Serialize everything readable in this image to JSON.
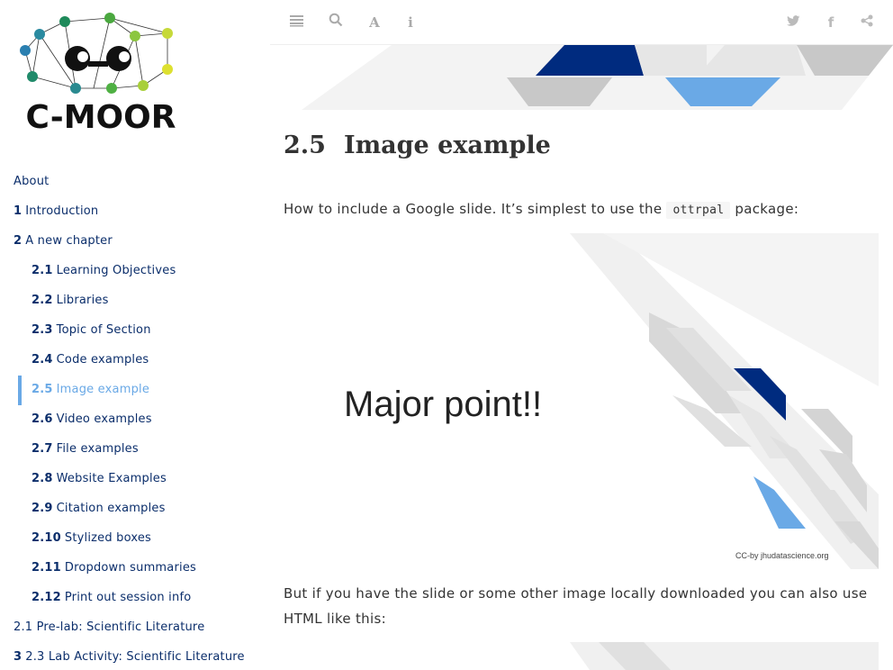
{
  "logo": {
    "text": "C-MOOR"
  },
  "toc": [
    {
      "num": "",
      "label": "About",
      "active": false
    },
    {
      "num": "1",
      "label": "Introduction",
      "active": false
    },
    {
      "num": "2",
      "label": "A new chapter",
      "active": false
    },
    {
      "num": "2.1",
      "label": "Learning Objectives",
      "active": false
    },
    {
      "num": "2.2",
      "label": "Libraries",
      "active": false
    },
    {
      "num": "2.3",
      "label": "Topic of Section",
      "active": false
    },
    {
      "num": "2.4",
      "label": "Code examples",
      "active": false
    },
    {
      "num": "2.5",
      "label": "Image example",
      "active": true
    },
    {
      "num": "2.6",
      "label": "Video examples",
      "active": false
    },
    {
      "num": "2.7",
      "label": "File examples",
      "active": false
    },
    {
      "num": "2.8",
      "label": "Website Examples",
      "active": false
    },
    {
      "num": "2.9",
      "label": "Citation examples",
      "active": false
    },
    {
      "num": "2.10",
      "label": "Stylized boxes",
      "active": false
    },
    {
      "num": "2.11",
      "label": "Dropdown summaries",
      "active": false
    },
    {
      "num": "2.12",
      "label": "Print out session info",
      "active": false
    },
    {
      "num": "",
      "label": "2.1 Pre-lab: Scientific Literature",
      "active": false
    },
    {
      "num": "3",
      "label": "2.3 Lab Activity: Scientific Literature",
      "active": false
    }
  ],
  "toolbar": {
    "left": [
      {
        "name": "toc-toggle-icon",
        "glyph": "≣"
      },
      {
        "name": "search-icon",
        "glyph": "⚲"
      },
      {
        "name": "font-settings-icon",
        "glyph": "A"
      },
      {
        "name": "info-icon",
        "glyph": "i"
      }
    ],
    "right": [
      {
        "name": "twitter-icon",
        "glyph": "🐦"
      },
      {
        "name": "facebook-icon",
        "glyph": "f"
      },
      {
        "name": "share-icon",
        "glyph": "⋖"
      }
    ]
  },
  "section": {
    "number": "2.5",
    "title": "Image example",
    "intro_before": "How to include a Google slide. It’s simplest to use the ",
    "intro_code": "ottrpal",
    "intro_after": " package:",
    "slide_text": "Major point!!",
    "slide_credit": "CC-by jhudatascience.org",
    "outro": "But if you have the slide or some other image locally downloaded you can also use HTML like this:"
  },
  "colors": {
    "accent": "#6aa9e6",
    "navy": "#002b7f",
    "link": "#0b2e6b",
    "light_gray": "#e8e8e8",
    "mid_gray": "#d0d0d0"
  }
}
